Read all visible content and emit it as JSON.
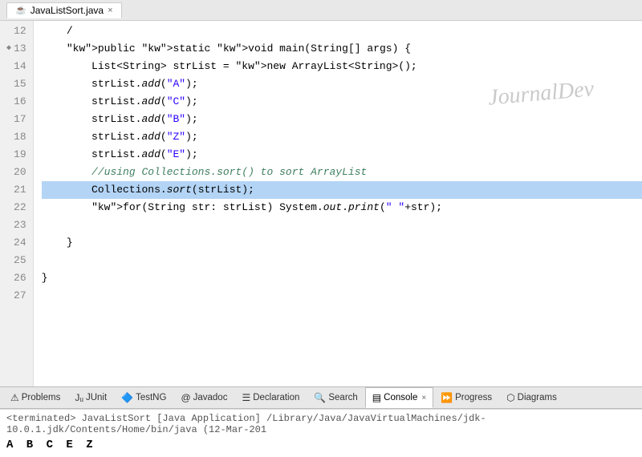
{
  "titleBar": {
    "tabLabel": "JavaListSort.java",
    "tabClose": "×"
  },
  "editor": {
    "watermark": "JournalDev",
    "lines": [
      {
        "num": "12",
        "arrow": false,
        "content": "    /"
      },
      {
        "num": "13",
        "arrow": true,
        "content": "    public static void main(String[] args) {"
      },
      {
        "num": "14",
        "arrow": false,
        "content": "        List<String> strList = new ArrayList<String>();"
      },
      {
        "num": "15",
        "arrow": false,
        "content": "        strList.add(\"A\");"
      },
      {
        "num": "16",
        "arrow": false,
        "content": "        strList.add(\"C\");"
      },
      {
        "num": "17",
        "arrow": false,
        "content": "        strList.add(\"B\");"
      },
      {
        "num": "18",
        "arrow": false,
        "content": "        strList.add(\"Z\");"
      },
      {
        "num": "19",
        "arrow": false,
        "content": "        strList.add(\"E\");"
      },
      {
        "num": "20",
        "arrow": false,
        "content": "        //using Collections.sort() to sort ArrayList"
      },
      {
        "num": "21",
        "arrow": false,
        "content": "        Collections.sort(strList);",
        "highlight": true
      },
      {
        "num": "22",
        "arrow": false,
        "content": "        for(String str: strList) System.out.print(\" \"+str);"
      },
      {
        "num": "23",
        "arrow": false,
        "content": ""
      },
      {
        "num": "24",
        "arrow": false,
        "content": "    }"
      },
      {
        "num": "25",
        "arrow": false,
        "content": ""
      },
      {
        "num": "26",
        "arrow": false,
        "content": "}"
      },
      {
        "num": "27",
        "arrow": false,
        "content": ""
      }
    ]
  },
  "tabBar": {
    "tabs": [
      {
        "id": "problems",
        "label": "Problems",
        "icon": "⚠",
        "active": false,
        "hasClose": false
      },
      {
        "id": "junit",
        "label": "JUnit",
        "icon": "Jᵤ",
        "active": false,
        "hasClose": false
      },
      {
        "id": "testng",
        "label": "TestNG",
        "icon": "🔷",
        "active": false,
        "hasClose": false
      },
      {
        "id": "javadoc",
        "label": "Javadoc",
        "icon": "@",
        "active": false,
        "hasClose": false
      },
      {
        "id": "declaration",
        "label": "Declaration",
        "icon": "📋",
        "active": false,
        "hasClose": false
      },
      {
        "id": "search",
        "label": "Search",
        "icon": "🔍",
        "active": false,
        "hasClose": false
      },
      {
        "id": "console",
        "label": "Console",
        "icon": "🖥",
        "active": true,
        "hasClose": true
      },
      {
        "id": "progress",
        "label": "Progress",
        "icon": "⏳",
        "active": false,
        "hasClose": false
      },
      {
        "id": "diagrams",
        "label": "Diagrams",
        "icon": "📊",
        "active": false,
        "hasClose": false
      }
    ]
  },
  "console": {
    "terminatedLine": "<terminated> JavaListSort [Java Application] /Library/Java/JavaVirtualMachines/jdk-10.0.1.jdk/Contents/Home/bin/java (12-Mar-201",
    "output": "A B C E Z"
  }
}
